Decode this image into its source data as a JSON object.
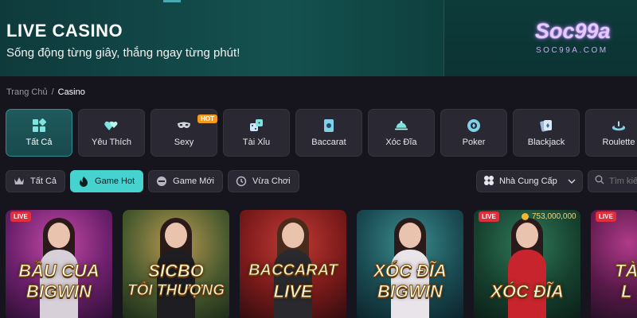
{
  "banner": {
    "title": "LIVE CASINO",
    "subtitle": "Sống động từng giây, thắng ngay từng phút!",
    "logo": "Soc99a",
    "logo_sub": "SOC99A.COM"
  },
  "breadcrumb": {
    "home": "Trang Chủ",
    "separator": "/",
    "current": "Casino"
  },
  "categories": [
    {
      "label": "Tất Cả",
      "icon": "grid-icon",
      "active": true
    },
    {
      "label": "Yêu Thích",
      "icon": "hearts-icon"
    },
    {
      "label": "Sexy",
      "icon": "mask-icon",
      "badge": "HOT"
    },
    {
      "label": "Tài Xỉu",
      "icon": "dice-icon"
    },
    {
      "label": "Baccarat",
      "icon": "card-icon"
    },
    {
      "label": "Xóc Đĩa",
      "icon": "bell-dish-icon"
    },
    {
      "label": "Poker",
      "icon": "chip-icon"
    },
    {
      "label": "Blackjack",
      "icon": "cards-icon"
    },
    {
      "label": "Roulette",
      "icon": "roulette-icon"
    }
  ],
  "filters": [
    {
      "label": "Tất Cả",
      "icon": "crown-icon"
    },
    {
      "label": "Game Hot",
      "icon": "fire-icon",
      "active": true
    },
    {
      "label": "Game Mới",
      "icon": "new-icon"
    },
    {
      "label": "Vừa Chơi",
      "icon": "clock-icon"
    }
  ],
  "provider": {
    "label": "Nhà Cung Cấp"
  },
  "search": {
    "placeholder": "Tìm kiếm"
  },
  "games": [
    {
      "line1": "BẦU CUA",
      "line2": "BIGWIN",
      "live": "LIVE"
    },
    {
      "line1": "SICBO",
      "line2": "TỐI THƯỢNG"
    },
    {
      "line1": "BACCARAT",
      "line2": "LIVE"
    },
    {
      "line1": "XÓC ĐĨA",
      "line2": "BIGWIN"
    },
    {
      "line1": "XÓC ĐĨA",
      "line2": "",
      "live": "LIVE",
      "jackpot": "753,000,000"
    },
    {
      "line1": "TÀ",
      "line2": "L",
      "live": "LIVE"
    }
  ],
  "colors": {
    "accent": "#46d3d0",
    "live": "#e02e3c",
    "hot": "#f39a1a"
  }
}
